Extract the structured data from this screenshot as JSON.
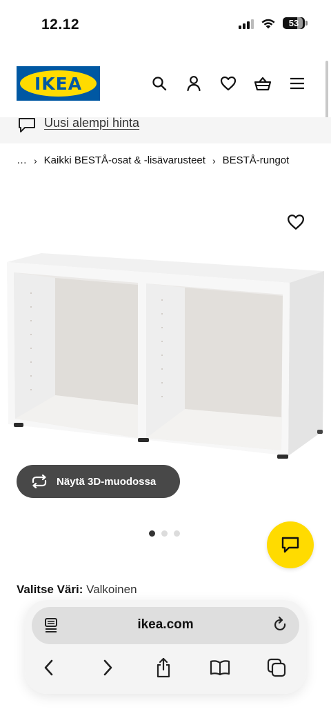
{
  "status_bar": {
    "time": "12.12",
    "battery": "53"
  },
  "header": {
    "logo_text": "IKEA",
    "icons": [
      "search-icon",
      "account-icon",
      "favourites-icon",
      "basket-icon",
      "menu-icon"
    ]
  },
  "promo": {
    "link_text": "Uusi alempi hinta",
    "icon": "chat-bubble-icon"
  },
  "breadcrumb": {
    "ellipsis": "…",
    "items": [
      "Kaikki BESTÅ-osat & -lisävarusteet",
      "BESTÅ-rungot"
    ]
  },
  "product": {
    "view_3d_label": "Näytä 3D-muodossa",
    "image_count": 3,
    "active_image": 1,
    "color_label": "Valitse Väri:",
    "color_value": "Valkoinen"
  },
  "colors": {
    "ikea_blue": "#0058a3",
    "ikea_yellow": "#ffdb00",
    "button_dark": "#484848"
  },
  "browser": {
    "url": "ikea.com",
    "toolbar_icons": [
      "back-icon",
      "forward-icon",
      "share-icon",
      "bookmarks-icon",
      "tabs-icon"
    ]
  }
}
